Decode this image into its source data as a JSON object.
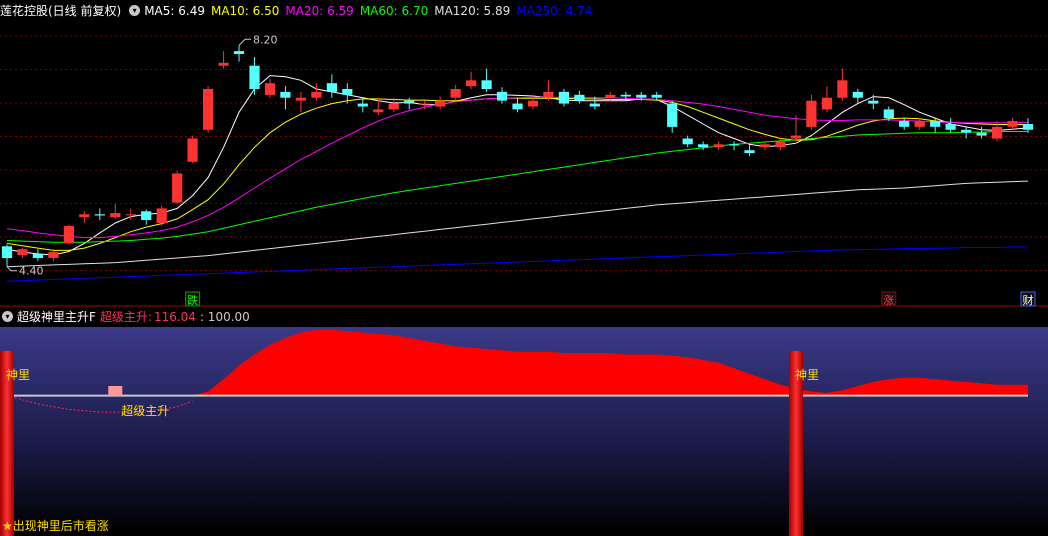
{
  "title": "莲花控股(日线 前复权)",
  "ma_legend": [
    {
      "label": "MA5: 6.49",
      "color": "#ffffff"
    },
    {
      "label": "MA10: 6.50",
      "color": "#ffff00"
    },
    {
      "label": "MA20: 6.59",
      "color": "#ff00ff"
    },
    {
      "label": "MA60: 6.70",
      "color": "#00ff00"
    },
    {
      "label": "MA120: 5.89",
      "color": "#e0e0e0"
    },
    {
      "label": "MA250: 4.74",
      "color": "#0000ff"
    }
  ],
  "colors": {
    "up": "#ff3232",
    "down": "#54ffff",
    "bg": "#000000",
    "grid": "#800000"
  },
  "annotations": {
    "high": "8.20",
    "low": "4.40",
    "markers": [
      {
        "text": "跌",
        "color": "#00ff00",
        "border": "#00a000"
      },
      {
        "text": "涨",
        "color": "#ff4040",
        "border": "#a00000"
      },
      {
        "text": "财",
        "color": "#ffffff",
        "border": "#4060ff"
      }
    ]
  },
  "sub": {
    "indicator_name": "超级神里主升F",
    "line_label": "超级主升:",
    "line_value": "116.04",
    "ref_value": ": 100.00",
    "signal_label": "神里",
    "signal2_label": "超级主升",
    "footer": "★出现神里后市看涨"
  },
  "chart_data": {
    "type": "candlestick",
    "ylim": [
      4.0,
      8.6
    ],
    "candles": [
      [
        4.75,
        4.55,
        4.78,
        4.4
      ],
      [
        4.6,
        4.7,
        4.72,
        4.55
      ],
      [
        4.62,
        4.55,
        4.7,
        4.5
      ],
      [
        4.55,
        4.65,
        4.7,
        4.5
      ],
      [
        4.8,
        5.1,
        5.12,
        4.78
      ],
      [
        5.25,
        5.3,
        5.35,
        5.15
      ],
      [
        5.3,
        5.28,
        5.4,
        5.2
      ],
      [
        5.25,
        5.32,
        5.48,
        5.22
      ],
      [
        5.3,
        5.3,
        5.4,
        5.2
      ],
      [
        5.35,
        5.2,
        5.38,
        5.12
      ],
      [
        5.15,
        5.4,
        5.45,
        5.1
      ],
      [
        5.5,
        6.0,
        6.05,
        5.48
      ],
      [
        6.2,
        6.6,
        6.65,
        6.18
      ],
      [
        6.75,
        7.45,
        7.5,
        6.7
      ],
      [
        7.85,
        7.9,
        8.1,
        7.8
      ],
      [
        8.1,
        8.05,
        8.2,
        7.92
      ],
      [
        7.85,
        7.45,
        8.0,
        7.35
      ],
      [
        7.35,
        7.55,
        7.62,
        7.3
      ],
      [
        7.4,
        7.3,
        7.5,
        7.1
      ],
      [
        7.25,
        7.3,
        7.4,
        7.05
      ],
      [
        7.3,
        7.4,
        7.55,
        7.25
      ],
      [
        7.55,
        7.4,
        7.7,
        7.3
      ],
      [
        7.45,
        7.35,
        7.55,
        7.2
      ],
      [
        7.2,
        7.15,
        7.28,
        7.05
      ],
      [
        7.05,
        7.1,
        7.3,
        7.0
      ],
      [
        7.1,
        7.2,
        7.3,
        7.05
      ],
      [
        7.25,
        7.2,
        7.3,
        7.1
      ],
      [
        7.2,
        7.2,
        7.25,
        7.1
      ],
      [
        7.15,
        7.25,
        7.32,
        7.1
      ],
      [
        7.3,
        7.45,
        7.52,
        7.25
      ],
      [
        7.5,
        7.6,
        7.75,
        7.45
      ],
      [
        7.6,
        7.45,
        7.8,
        7.4
      ],
      [
        7.4,
        7.25,
        7.48,
        7.2
      ],
      [
        7.2,
        7.1,
        7.3,
        7.05
      ],
      [
        7.15,
        7.25,
        7.35,
        7.1
      ],
      [
        7.3,
        7.4,
        7.6,
        7.25
      ],
      [
        7.4,
        7.2,
        7.45,
        7.15
      ],
      [
        7.35,
        7.25,
        7.42,
        7.2
      ],
      [
        7.2,
        7.15,
        7.32,
        7.1
      ],
      [
        7.3,
        7.35,
        7.4,
        7.25
      ],
      [
        7.35,
        7.32,
        7.4,
        7.28
      ],
      [
        7.35,
        7.3,
        7.4,
        7.25
      ],
      [
        7.35,
        7.3,
        7.4,
        7.25
      ],
      [
        7.2,
        6.8,
        7.25,
        6.7
      ],
      [
        6.6,
        6.5,
        6.65,
        6.45
      ],
      [
        6.5,
        6.45,
        6.55,
        6.4
      ],
      [
        6.45,
        6.5,
        6.55,
        6.4
      ],
      [
        6.5,
        6.48,
        6.55,
        6.4
      ],
      [
        6.4,
        6.35,
        6.5,
        6.3
      ],
      [
        6.45,
        6.5,
        6.55,
        6.4
      ],
      [
        6.45,
        6.55,
        6.6,
        6.4
      ],
      [
        6.6,
        6.65,
        7.0,
        6.55
      ],
      [
        6.8,
        7.25,
        7.35,
        6.75
      ],
      [
        7.1,
        7.3,
        7.5,
        7.05
      ],
      [
        7.3,
        7.6,
        7.8,
        7.25
      ],
      [
        7.4,
        7.3,
        7.45,
        7.2
      ],
      [
        7.25,
        7.2,
        7.35,
        7.1
      ],
      [
        7.1,
        6.95,
        7.15,
        6.9
      ],
      [
        6.9,
        6.8,
        6.95,
        6.75
      ],
      [
        6.8,
        6.9,
        6.95,
        6.75
      ],
      [
        6.9,
        6.8,
        6.95,
        6.7
      ],
      [
        6.85,
        6.75,
        6.95,
        6.7
      ],
      [
        6.75,
        6.7,
        6.8,
        6.6
      ],
      [
        6.7,
        6.65,
        6.8,
        6.6
      ],
      [
        6.6,
        6.8,
        6.9,
        6.55
      ],
      [
        6.8,
        6.9,
        6.95,
        6.75
      ],
      [
        6.85,
        6.75,
        6.95,
        6.7
      ]
    ],
    "ma_lines": [
      {
        "name": "MA5",
        "color": "#ffffff",
        "values": [
          4.7,
          4.65,
          4.62,
          4.6,
          4.66,
          4.8,
          4.98,
          5.15,
          5.26,
          5.3,
          5.32,
          5.4,
          5.62,
          5.93,
          6.45,
          7.05,
          7.45,
          7.68,
          7.66,
          7.6,
          7.45,
          7.4,
          7.35,
          7.3,
          7.25,
          7.21,
          7.22,
          7.18,
          7.18,
          7.24,
          7.3,
          7.35,
          7.35,
          7.34,
          7.33,
          7.3,
          7.26,
          7.25,
          7.25,
          7.25,
          7.25,
          7.28,
          7.27,
          7.15,
          7.0,
          6.85,
          6.7,
          6.6,
          6.5,
          6.46,
          6.48,
          6.52,
          6.65,
          6.85,
          7.05,
          7.2,
          7.32,
          7.3,
          7.18,
          7.05,
          6.95,
          6.85,
          6.8,
          6.75,
          6.74,
          6.76,
          6.78
        ]
      },
      {
        "name": "MA10",
        "color": "#ffff00",
        "values": [
          4.8,
          4.76,
          4.72,
          4.68,
          4.68,
          4.72,
          4.8,
          4.9,
          5.0,
          5.08,
          5.14,
          5.22,
          5.38,
          5.55,
          5.82,
          6.15,
          6.45,
          6.7,
          6.88,
          7.02,
          7.12,
          7.2,
          7.25,
          7.28,
          7.28,
          7.27,
          7.26,
          7.26,
          7.25,
          7.25,
          7.26,
          7.28,
          7.29,
          7.29,
          7.29,
          7.29,
          7.29,
          7.28,
          7.28,
          7.27,
          7.27,
          7.27,
          7.26,
          7.22,
          7.15,
          7.05,
          6.95,
          6.85,
          6.75,
          6.67,
          6.6,
          6.57,
          6.58,
          6.64,
          6.73,
          6.83,
          6.9,
          6.94,
          6.95,
          6.94,
          6.9,
          6.88,
          6.86,
          6.85,
          6.84,
          6.84,
          6.84
        ]
      },
      {
        "name": "MA20",
        "color": "#ff00ff",
        "values": [
          5.05,
          5.02,
          4.98,
          4.95,
          4.92,
          4.9,
          4.9,
          4.92,
          4.95,
          4.98,
          5.02,
          5.08,
          5.17,
          5.28,
          5.42,
          5.58,
          5.75,
          5.92,
          6.08,
          6.24,
          6.38,
          6.52,
          6.65,
          6.78,
          6.9,
          7.0,
          7.08,
          7.14,
          7.19,
          7.23,
          7.26,
          7.28,
          7.29,
          7.3,
          7.31,
          7.31,
          7.31,
          7.31,
          7.3,
          7.3,
          7.29,
          7.28,
          7.27,
          7.25,
          7.22,
          7.19,
          7.15,
          7.1,
          7.05,
          7.0,
          6.97,
          6.94,
          6.92,
          6.91,
          6.91,
          6.92,
          6.92,
          6.92,
          6.91,
          6.9,
          6.88,
          6.88,
          6.87,
          6.87,
          6.87,
          6.87,
          6.88
        ]
      },
      {
        "name": "MA60",
        "color": "#00ff00",
        "values": [
          4.85,
          4.84,
          4.83,
          4.82,
          4.82,
          4.82,
          4.83,
          4.84,
          4.85,
          4.87,
          4.89,
          4.92,
          4.96,
          5.0,
          5.06,
          5.12,
          5.18,
          5.24,
          5.3,
          5.36,
          5.42,
          5.47,
          5.52,
          5.57,
          5.62,
          5.67,
          5.71,
          5.75,
          5.79,
          5.83,
          5.87,
          5.91,
          5.95,
          5.99,
          6.03,
          6.07,
          6.11,
          6.15,
          6.19,
          6.23,
          6.27,
          6.31,
          6.35,
          6.38,
          6.41,
          6.44,
          6.47,
          6.5,
          6.52,
          6.54,
          6.56,
          6.58,
          6.6,
          6.62,
          6.64,
          6.66,
          6.67,
          6.68,
          6.69,
          6.7,
          6.7,
          6.7,
          6.71,
          6.71,
          6.72,
          6.72,
          6.72
        ]
      },
      {
        "name": "MA120",
        "color": "#e0e0e0",
        "values": [
          4.4,
          4.41,
          4.42,
          4.43,
          4.44,
          4.45,
          4.46,
          4.47,
          4.49,
          4.51,
          4.53,
          4.55,
          4.57,
          4.59,
          4.62,
          4.65,
          4.68,
          4.71,
          4.74,
          4.77,
          4.8,
          4.83,
          4.86,
          4.89,
          4.92,
          4.95,
          4.98,
          5.01,
          5.04,
          5.07,
          5.1,
          5.13,
          5.16,
          5.19,
          5.22,
          5.25,
          5.28,
          5.31,
          5.34,
          5.37,
          5.4,
          5.43,
          5.46,
          5.48,
          5.5,
          5.52,
          5.54,
          5.56,
          5.58,
          5.6,
          5.62,
          5.64,
          5.66,
          5.68,
          5.7,
          5.72,
          5.73,
          5.74,
          5.75,
          5.77,
          5.79,
          5.81,
          5.83,
          5.84,
          5.85,
          5.86,
          5.87
        ]
      },
      {
        "name": "MA250",
        "color": "#0000ff",
        "values": [
          4.15,
          4.16,
          4.17,
          4.18,
          4.19,
          4.2,
          4.21,
          4.22,
          4.23,
          4.24,
          4.25,
          4.26,
          4.27,
          4.28,
          4.29,
          4.3,
          4.31,
          4.32,
          4.33,
          4.34,
          4.35,
          4.36,
          4.37,
          4.38,
          4.39,
          4.4,
          4.41,
          4.42,
          4.43,
          4.44,
          4.45,
          4.46,
          4.47,
          4.48,
          4.49,
          4.5,
          4.51,
          4.52,
          4.53,
          4.54,
          4.55,
          4.56,
          4.57,
          4.58,
          4.59,
          4.6,
          4.61,
          4.62,
          4.63,
          4.64,
          4.65,
          4.66,
          4.67,
          4.68,
          4.69,
          4.69,
          4.7,
          4.7,
          4.71,
          4.71,
          4.72,
          4.72,
          4.73,
          4.73,
          4.73,
          4.74,
          4.74
        ]
      }
    ],
    "sub_ylim": [
      0,
      150
    ],
    "ref_level": 100,
    "sub_area": [
      100,
      97,
      94,
      92,
      90,
      89,
      88,
      88,
      88,
      89,
      90,
      92,
      96,
      103,
      112,
      122,
      130,
      137,
      142,
      146,
      148,
      148,
      147,
      146,
      145,
      144,
      142,
      140,
      138,
      136,
      135,
      134,
      133,
      132,
      132,
      132,
      131,
      131,
      131,
      131,
      130,
      130,
      130,
      129,
      128,
      126,
      124,
      120,
      116,
      112,
      108,
      105,
      103,
      102,
      104,
      107,
      110,
      112,
      113,
      113,
      112,
      111,
      110,
      109,
      108,
      108,
      108
    ],
    "signal_bars": [
      0,
      51
    ],
    "signal2_bar": 7
  }
}
